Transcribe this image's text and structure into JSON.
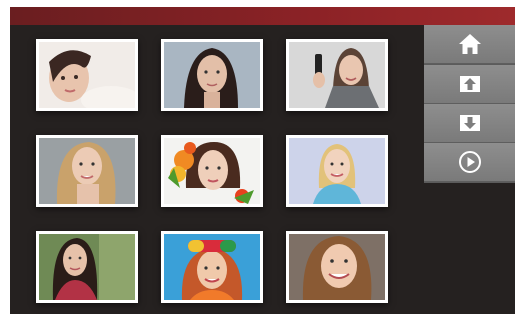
{
  "topbar": {
    "color": "#8c2226"
  },
  "gallery": {
    "photos": [
      {
        "name": "photo-woman-reclining",
        "interactable": true
      },
      {
        "name": "photo-woman-dark-hair",
        "interactable": true
      },
      {
        "name": "photo-woman-with-phone",
        "interactable": true
      },
      {
        "name": "photo-woman-blonde-long-hair",
        "interactable": true
      },
      {
        "name": "photo-woman-with-flowers",
        "interactable": true
      },
      {
        "name": "photo-woman-blonde-smiling",
        "interactable": true
      },
      {
        "name": "photo-woman-outdoors",
        "interactable": true
      },
      {
        "name": "photo-woman-colorful-hat",
        "interactable": true
      },
      {
        "name": "photo-woman-laughing",
        "interactable": true
      }
    ]
  },
  "side_menu": {
    "buttons": [
      {
        "icon": "home-icon"
      },
      {
        "icon": "arrow-up-icon"
      },
      {
        "icon": "arrow-down-icon"
      },
      {
        "icon": "play-icon"
      }
    ]
  }
}
